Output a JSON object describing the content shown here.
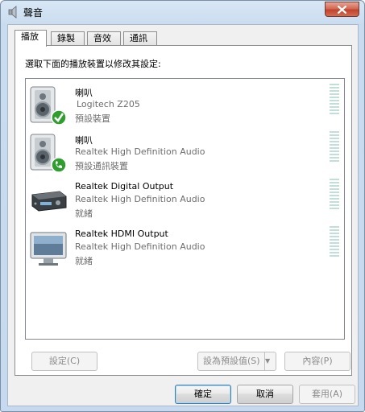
{
  "window": {
    "title": "聲音"
  },
  "tabs": [
    {
      "label": "播放"
    },
    {
      "label": "錄製"
    },
    {
      "label": "音效"
    },
    {
      "label": "通訊"
    }
  ],
  "panel": {
    "instruction": "選取下面的播放裝置以修改其設定:"
  },
  "devices": [
    {
      "name": "喇叭",
      "description": "Logitech Z205",
      "status": "預設裝置",
      "icon": "speaker-icon",
      "badge": "check-icon"
    },
    {
      "name": "喇叭",
      "description": "Realtek High Definition Audio",
      "status": "預設通訊裝置",
      "icon": "speaker-icon",
      "badge": "phone-icon"
    },
    {
      "name": "Realtek Digital Output",
      "description": "Realtek High Definition Audio",
      "status": "就緒",
      "icon": "receiver-icon"
    },
    {
      "name": "Realtek HDMI Output",
      "description": "Realtek High Definition Audio",
      "status": "就緒",
      "icon": "monitor-icon"
    }
  ],
  "panel_buttons": {
    "configure": "設定(C)",
    "set_default": "設為預設值(S)",
    "properties": "內容(P)"
  },
  "dialog_buttons": {
    "ok": "確定",
    "cancel": "取消",
    "apply": "套用(A)"
  },
  "colors": {
    "meter": "#c2dfd7",
    "check": "#2f9e2f",
    "titlebar": "#c9dcef"
  }
}
